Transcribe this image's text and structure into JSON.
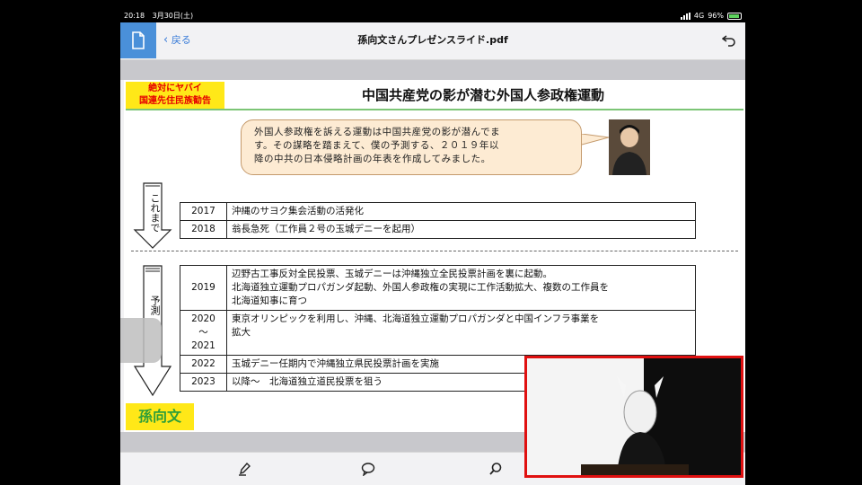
{
  "status_bar": {
    "time": "20:18",
    "date": "3月30日(土)",
    "network": "4G",
    "battery_percent": "96%"
  },
  "nav": {
    "back_label": "戻る",
    "title": "孫向文さんプレゼンスライド.pdf"
  },
  "slide": {
    "badge_line1": "絶対にヤバイ",
    "badge_line2": "国連先住民族勧告",
    "title": "中国共産党の影が潜む外国人参政権運動",
    "bubble_line1": "外国人参政権を訴える運動は中国共産党の影が潜んでま",
    "bubble_line2": "す。その謀略を踏まえて、僕の予測する、２０１９年以",
    "bubble_line3": "降の中共の日本侵略計画の年表を作成してみました。",
    "past_label": "これまで",
    "forecast_label": "予測",
    "past_rows": [
      {
        "year": "2017",
        "event": "沖縄のサヨク集会活動の活発化"
      },
      {
        "year": "2018",
        "event": "翁長急死（工作員２号の玉城デニーを起用）"
      }
    ],
    "future_rows": [
      {
        "year": "2019",
        "event_line1": "辺野古工事反対全民投票、玉城デニーは沖縄独立全民投票計画を裏に起動。",
        "event_line2": "北海道独立運動プロパガンダ起動、外国人参政権の実現に工作活動拡大、複数の工作員を",
        "event_line3": "北海道知事に育つ"
      },
      {
        "year_line1": "2020",
        "year_line2": "～",
        "year_line3": "2021",
        "event_line1": "東京オリンピックを利用し、沖縄、北海道独立運動プロパガンダと中国インフラ事業を",
        "event_line2": "拡大"
      },
      {
        "year": "2022",
        "event": "玉城デニー任期内で沖縄独立県民投票計画を実施"
      },
      {
        "year": "2023",
        "event": "以降～　北海道独立道民投票を狙う"
      }
    ],
    "author": "孫向文"
  },
  "colors": {
    "badge_bg": "#ffe818",
    "badge_text": "#e60000",
    "title_rule": "#7cc576",
    "bubble_bg": "#fdebd3",
    "author_text": "#2e9e3a",
    "overlay_border": "#e01010",
    "accent_blue": "#4a90d9"
  },
  "icons": {
    "doc": "document-icon",
    "back": "chevron-left-icon",
    "undo": "undo-icon",
    "annotate": "pen-icon",
    "comment": "comment-icon",
    "search": "search-icon"
  }
}
